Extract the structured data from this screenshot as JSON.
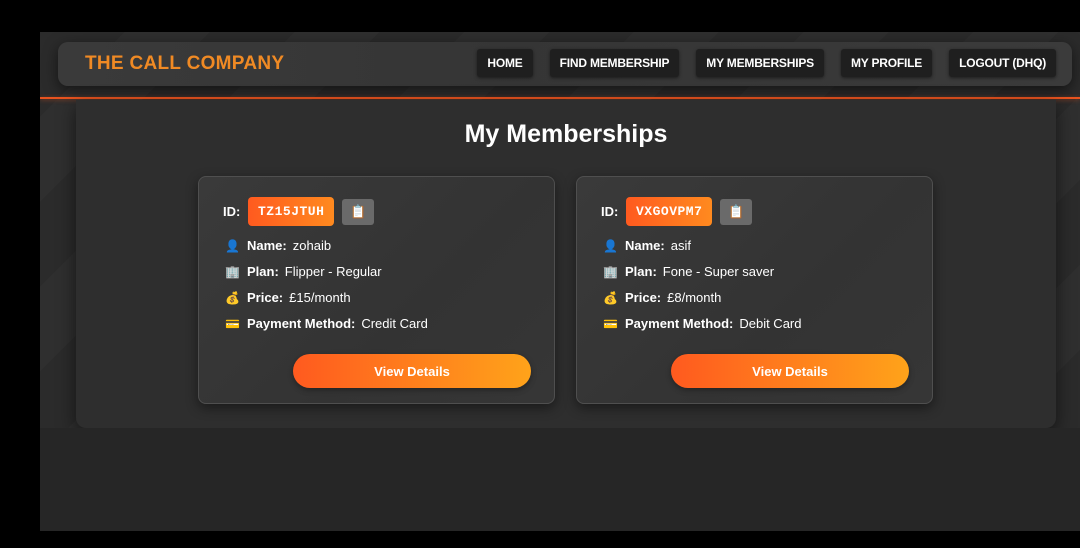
{
  "brand": {
    "name": "THE CALL COMPANY",
    "color": "#f08a24"
  },
  "nav": {
    "items": [
      {
        "label": "HOME"
      },
      {
        "label": "FIND MEMBERSHIP"
      },
      {
        "label": "MY MEMBERSHIPS"
      },
      {
        "label": "MY PROFILE"
      },
      {
        "label": "LOGOUT (DHQ)"
      }
    ]
  },
  "page": {
    "title": "My Memberships"
  },
  "labels": {
    "id": "ID:",
    "name": "Name:",
    "plan": "Plan:",
    "price": "Price:",
    "payment": "Payment Method:",
    "view_details": "View Details"
  },
  "icons": {
    "copy": "clipboard-icon",
    "name": "user-icon",
    "plan": "building-icon",
    "price": "money-bag-icon",
    "payment": "credit-card-icon"
  },
  "memberships": [
    {
      "id": "TZ15JTUH",
      "name": "zohaib",
      "plan": "Flipper - Regular",
      "price": "£15/month",
      "payment_method": "Credit Card"
    },
    {
      "id": "VXGOVPM7",
      "name": "asif",
      "plan": "Fone - Super saver",
      "price": "£8/month",
      "payment_method": "Debit Card"
    }
  ],
  "colors": {
    "accent": "#e8531f",
    "gradient_start": "#ff5a1f",
    "gradient_end": "#ffa31a"
  }
}
